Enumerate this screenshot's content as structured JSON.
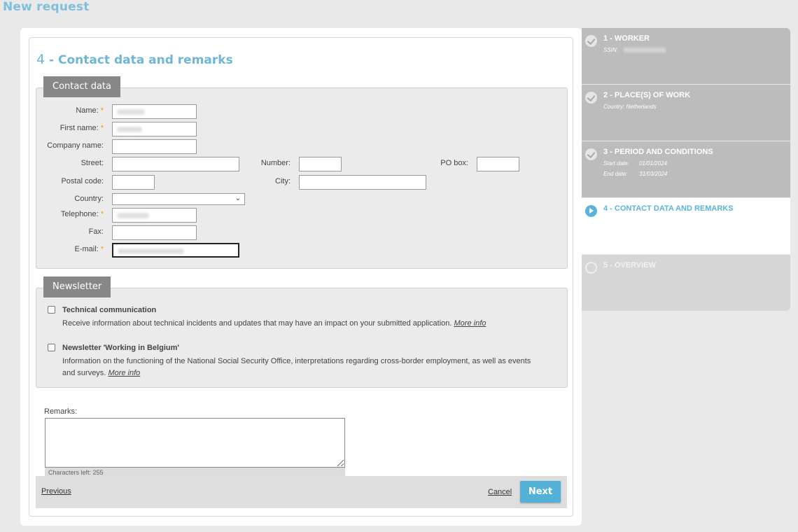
{
  "page": {
    "title": "New request"
  },
  "form": {
    "heading_number": "4",
    "heading_text": "- Contact data and remarks"
  },
  "contact": {
    "section_label": "Contact data",
    "required_marker": "*",
    "name_label": "Name:",
    "first_name_label": "First name:",
    "company_label": "Company name:",
    "street_label": "Street:",
    "number_label": "Number:",
    "po_box_label": "PO box:",
    "postal_code_label": "Postal code:",
    "city_label": "City:",
    "country_label": "Country:",
    "telephone_label": "Telephone:",
    "fax_label": "Fax:",
    "email_label": "E-mail:"
  },
  "newsletter": {
    "section_label": "Newsletter",
    "items": [
      {
        "title": "Technical communication",
        "text": "Receive information about technical incidents and updates that may have an impact on your submitted application.",
        "more": "More info",
        "checked": false
      },
      {
        "title": "Newsletter 'Working in Belgium'",
        "text": "Information on the functioning of the National Social Security Office, interpretations regarding cross-border employment, as well as events and surveys.",
        "more": "More info",
        "checked": false
      }
    ]
  },
  "remarks": {
    "label": "Remarks:",
    "chars_left": "Characters left: 255"
  },
  "actions": {
    "previous": "Previous",
    "cancel": "Cancel",
    "next": "Next"
  },
  "steps": [
    {
      "title": "1 - WORKER",
      "status": "done",
      "meta": [
        {
          "label": "SSIN:",
          "value": ""
        }
      ]
    },
    {
      "title": "2 - PLACE(S) OF WORK",
      "status": "done",
      "meta": [
        {
          "label": "Country: Netherlands",
          "value": ""
        }
      ]
    },
    {
      "title": "3 - PERIOD AND CONDITIONS",
      "status": "done",
      "meta": [
        {
          "label": "Start date:",
          "value": "01/01/2024"
        },
        {
          "label": "End date:",
          "value": "31/03/2024"
        }
      ]
    },
    {
      "title": "4 - CONTACT DATA AND REMARKS",
      "status": "active",
      "meta": []
    },
    {
      "title": "5 - OVERVIEW",
      "status": "todo",
      "meta": []
    }
  ],
  "colors": {
    "accent": "#5ab4d9",
    "title": "#7fbfdc",
    "tab": "#888788",
    "required": "#f0a000"
  }
}
